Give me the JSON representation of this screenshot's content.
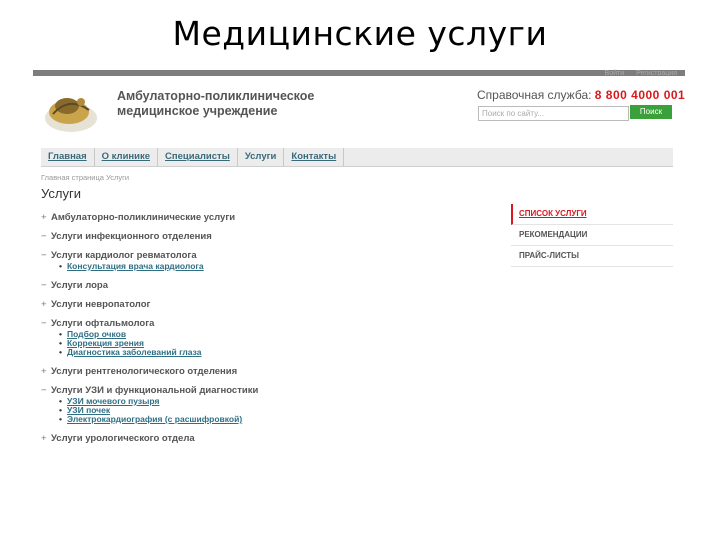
{
  "slide": {
    "title": "Медицинские услуги"
  },
  "header": {
    "auth_links": [
      "Войти",
      "Регистрация"
    ],
    "org_name": "Амбулаторно-поликлиническое медицинское учреждение",
    "help_label": "Справочная служба:",
    "help_phone": "8 800 4000 001",
    "search_placeholder": "Поиск по сайту...",
    "search_button": "Поиск"
  },
  "nav": {
    "items": [
      "Главная",
      "О клинике",
      "Специалисты",
      "Услуги",
      "Контакты"
    ]
  },
  "breadcrumbs": "Главная страница   Услуги",
  "page_heading": "Услуги",
  "services": [
    {
      "title": "Амбулаторно-поликлинические услуги",
      "marker": "+",
      "items": []
    },
    {
      "title": "Услуги инфекционного отделения",
      "marker": "−",
      "items": []
    },
    {
      "title": "Услуги кардиолог ревматолога",
      "marker": "−",
      "items": [
        "Консультация врача кардиолога"
      ]
    },
    {
      "title": "Услуги лора",
      "marker": "−",
      "items": []
    },
    {
      "title": "Услуги невропатолог",
      "marker": "+",
      "items": []
    },
    {
      "title": "Услуги офтальмолога",
      "marker": "−",
      "items": [
        "Подбор очков",
        "Коррекция зрения",
        "Диагностика заболеваний глаза"
      ]
    },
    {
      "title": "Услуги рентгенологического отделения",
      "marker": "+",
      "items": []
    },
    {
      "title": "Услуги УЗИ и функциональной диагностики",
      "marker": "−",
      "items": [
        "УЗИ мочевого пузыря",
        "УЗИ почек",
        "Электрокардиография (с расшифровкой)"
      ]
    },
    {
      "title": "Услуги урологического отдела",
      "marker": "+",
      "items": []
    }
  ],
  "sidebar": {
    "items": [
      "СПИСОК УСЛУГИ",
      "РЕКОМЕНДАЦИИ",
      "ПРАЙС-ЛИСТЫ"
    ]
  }
}
